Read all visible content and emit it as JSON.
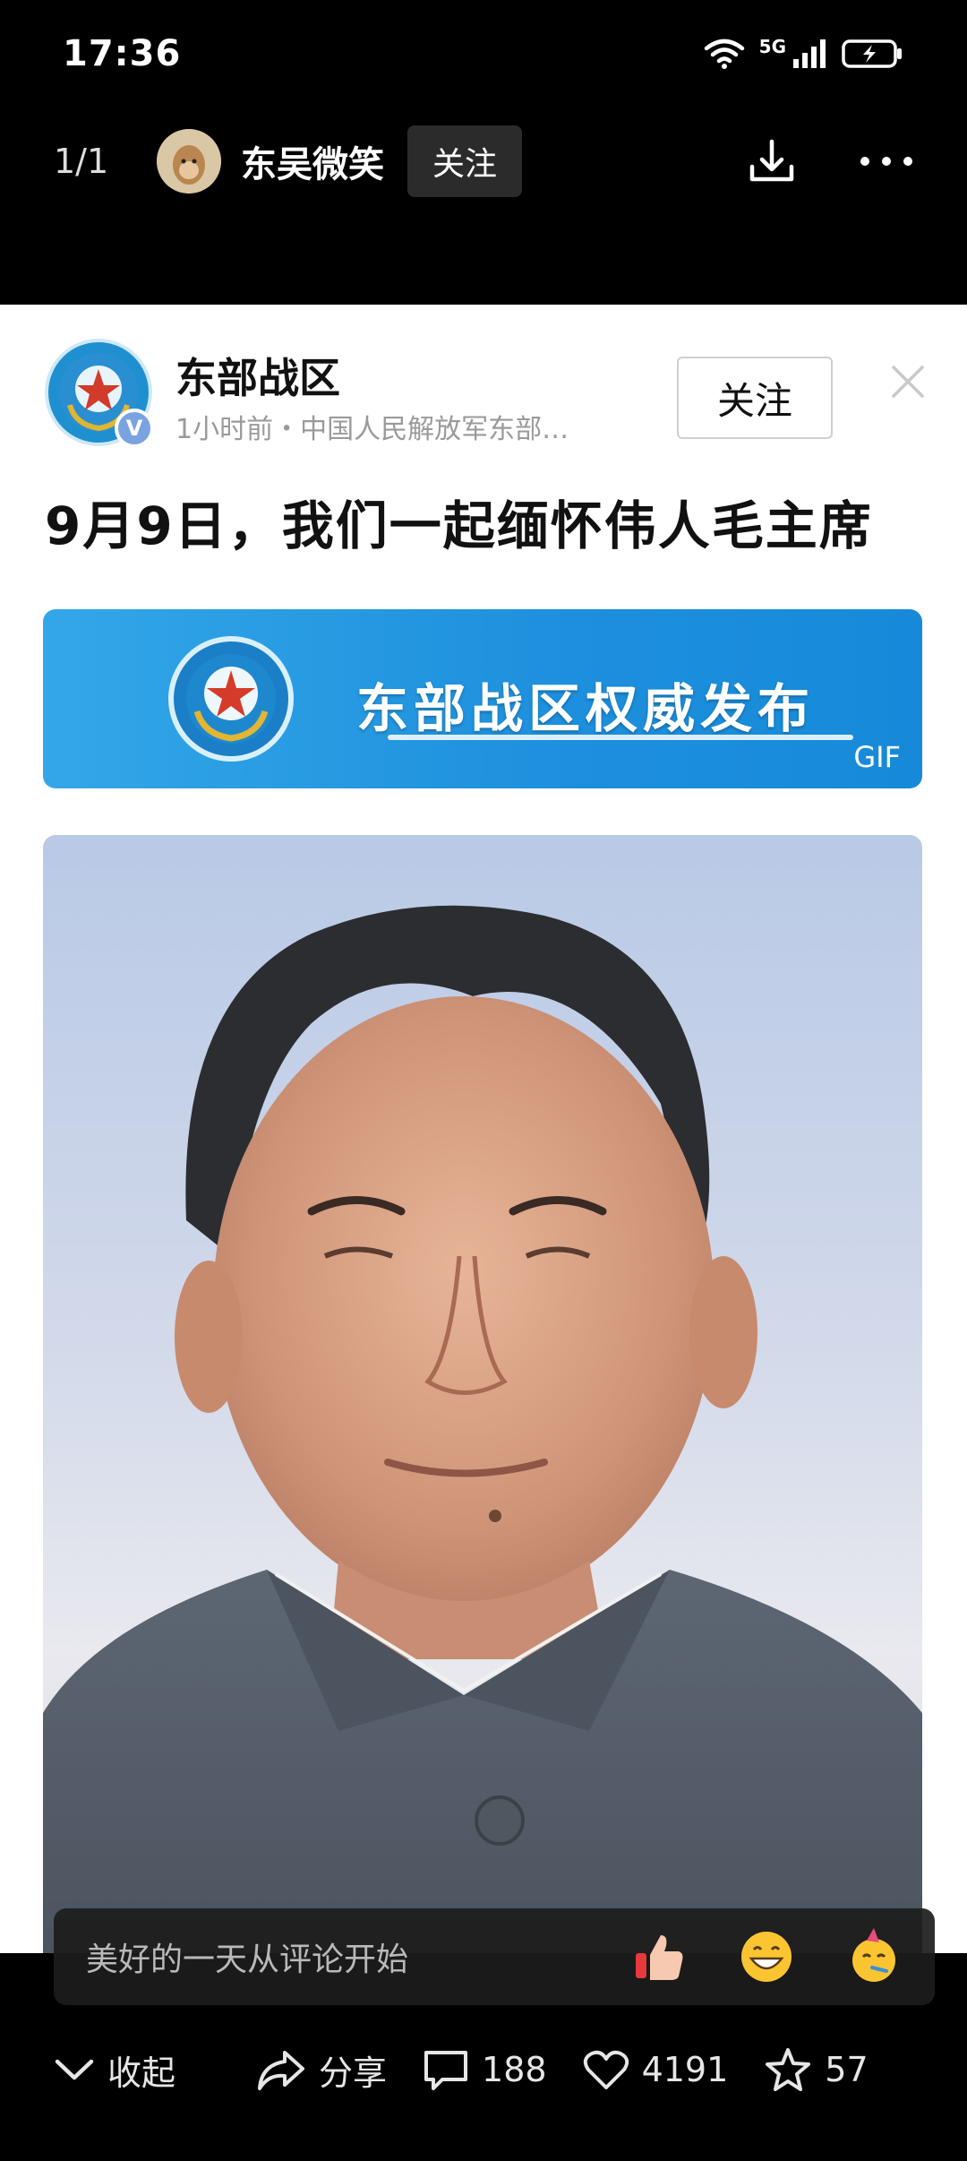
{
  "status_bar": {
    "time": "17:36",
    "network": "5G"
  },
  "viewer": {
    "page_counter": "1/1",
    "author_name": "东吴微笑",
    "follow_label": "关注"
  },
  "post": {
    "org_name": "东部战区",
    "verified_badge": "V",
    "meta": "1小时前・中国人民解放军东部…",
    "follow_label": "关注",
    "title": "9月9日，我们一起缅怀伟人毛主席",
    "banner_text": "东部战区权威发布",
    "banner_badge": "GIF"
  },
  "comment_bar": {
    "placeholder": "美好的一天从评论开始",
    "emojis": [
      "thumbs-up-icon",
      "grinning-face-icon",
      "party-face-icon"
    ]
  },
  "bottom_bar": {
    "collapse_label": "收起",
    "share_label": "分享",
    "comments_count": "188",
    "likes_count": "4191",
    "favorites_count": "57"
  },
  "colors": {
    "banner_blue": "#1d8fdd",
    "background": "#000000",
    "card": "#ffffff"
  }
}
